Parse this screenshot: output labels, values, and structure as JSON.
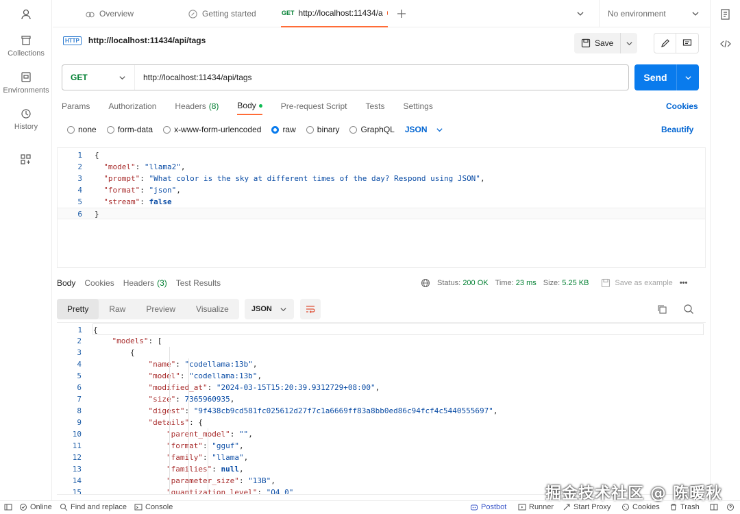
{
  "sidebar": {
    "items": [
      {
        "label": "",
        "icon": "user-icon"
      },
      {
        "label": "Collections",
        "icon": "trash-can-icon"
      },
      {
        "label": "Environments",
        "icon": "environment-icon"
      },
      {
        "label": "History",
        "icon": "history-icon"
      },
      {
        "label": "",
        "icon": "grid-plus-icon"
      }
    ]
  },
  "tabs": [
    {
      "label": "Overview",
      "icon": "overview-icon"
    },
    {
      "label": "Getting started",
      "icon": "getting-started-icon"
    },
    {
      "method": "GET",
      "label": "http://localhost:11434/a",
      "active": true
    }
  ],
  "environment": {
    "label": "No environment"
  },
  "request": {
    "title": "http://localhost:11434/api/tags",
    "http_icon_text": "HTTP",
    "save_label": "Save",
    "method": "GET",
    "url": "http://localhost:11434/api/tags",
    "send_label": "Send",
    "tabs": [
      {
        "label": "Params"
      },
      {
        "label": "Authorization"
      },
      {
        "label": "Headers",
        "count": "(8)"
      },
      {
        "label": "Body",
        "active": true
      },
      {
        "label": "Pre-request Script"
      },
      {
        "label": "Tests"
      },
      {
        "label": "Settings"
      }
    ],
    "cookies_label": "Cookies",
    "body_types": [
      "none",
      "form-data",
      "x-www-form-urlencoded",
      "raw",
      "binary",
      "GraphQL"
    ],
    "body_type_selected": "raw",
    "format": "JSON",
    "beautify_label": "Beautify",
    "body_lines": [
      {
        "n": "1",
        "text": "{"
      },
      {
        "n": "2",
        "key": "\"model\"",
        "val": "\"llama2\"",
        "tail": ","
      },
      {
        "n": "3",
        "key": "\"prompt\"",
        "val": "\"What color is the sky at different times of the day? Respond using JSON\"",
        "tail": ","
      },
      {
        "n": "4",
        "key": "\"format\"",
        "val": "\"json\"",
        "tail": ","
      },
      {
        "n": "5",
        "key": "\"stream\"",
        "val": "false",
        "tail": ""
      },
      {
        "n": "6",
        "text": "}"
      }
    ]
  },
  "response": {
    "tabs": [
      {
        "label": "Body",
        "active": true
      },
      {
        "label": "Cookies"
      },
      {
        "label": "Headers",
        "count": "(3)"
      },
      {
        "label": "Test Results"
      }
    ],
    "status_label": "Status:",
    "status_value": "200 OK",
    "time_label": "Time:",
    "time_value": "23 ms",
    "size_label": "Size:",
    "size_value": "5.25 KB",
    "save_example_label": "Save as example",
    "view_modes": [
      "Pretty",
      "Raw",
      "Preview",
      "Visualize"
    ],
    "format": "JSON",
    "lines": [
      {
        "n": "1",
        "text": "{"
      },
      {
        "n": "2",
        "key": "\"models\"",
        "tail": ": ["
      },
      {
        "n": "3",
        "text": "{"
      },
      {
        "n": "4",
        "key": "\"name\"",
        "val": "\"codellama:13b\"",
        "tail": ","
      },
      {
        "n": "5",
        "key": "\"model\"",
        "val": "\"codellama:13b\"",
        "tail": ","
      },
      {
        "n": "6",
        "key": "\"modified_at\"",
        "val": "\"2024-03-15T15:20:39.9312729+08:00\"",
        "tail": ","
      },
      {
        "n": "7",
        "key": "\"size\"",
        "val": "7365960935",
        "tail": ","
      },
      {
        "n": "8",
        "key": "\"digest\"",
        "val": "\"9f438cb9cd581fc025612d27f7c1a6669ff83a8bb0ed86c94fcf4c5440555697\"",
        "tail": ","
      },
      {
        "n": "9",
        "key": "\"details\"",
        "tail": ": {"
      },
      {
        "n": "10",
        "key": "\"parent_model\"",
        "val": "\"\"",
        "tail": ","
      },
      {
        "n": "11",
        "key": "\"format\"",
        "val": "\"gguf\"",
        "tail": ","
      },
      {
        "n": "12",
        "key": "\"family\"",
        "val": "\"llama\"",
        "tail": ","
      },
      {
        "n": "13",
        "key": "\"families\"",
        "val": "null",
        "tail": ","
      },
      {
        "n": "14",
        "key": "\"parameter_size\"",
        "val": "\"13B\"",
        "tail": ","
      },
      {
        "n": "15",
        "key": "\"quantization_level\"",
        "val": "\"Q4_0\"",
        "tail": ""
      }
    ]
  },
  "statusbar": {
    "online": "Online",
    "find_replace": "Find and replace",
    "console": "Console",
    "postbot": "Postbot",
    "runner": "Runner",
    "start_proxy": "Start Proxy",
    "cookies": "Cookies",
    "trash": "Trash"
  },
  "watermark": "掘金技术社区 @ 陈暖秋",
  "colors": {
    "accent": "#ff6c37",
    "send": "#097bed",
    "get": "#007f31",
    "link": "#0265d2"
  }
}
